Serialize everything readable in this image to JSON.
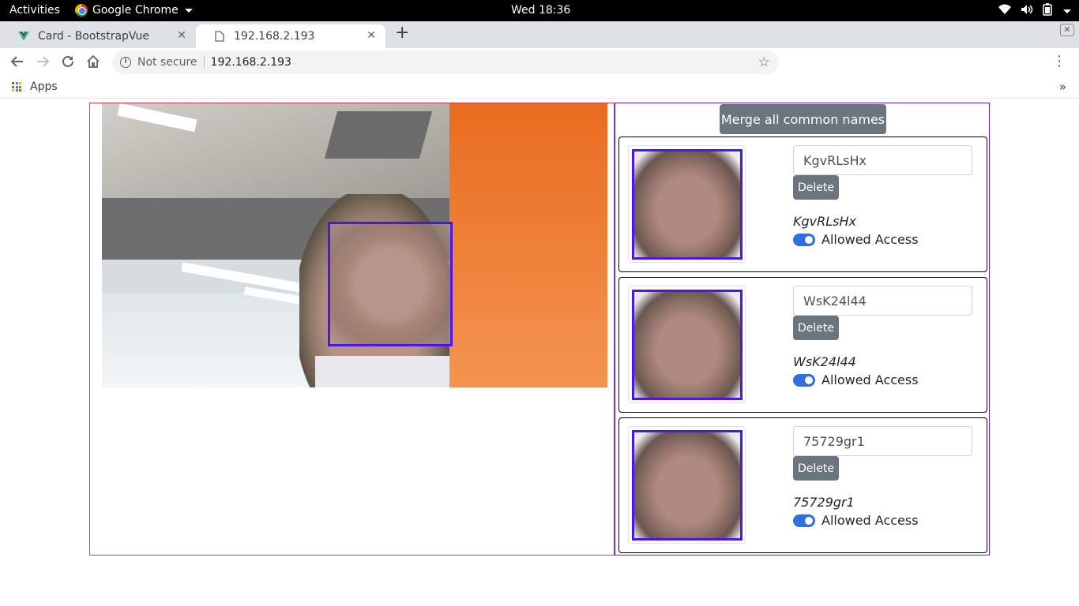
{
  "system": {
    "activities": "Activities",
    "app_name": "Google Chrome",
    "clock": "Wed 18:36"
  },
  "tabs": [
    {
      "title": "Card - BootstrapVue",
      "active": false
    },
    {
      "title": "192.168.2.193",
      "active": true
    }
  ],
  "omnibox": {
    "security": "Not secure",
    "url": "192.168.2.193"
  },
  "bookmarks": {
    "apps_label": "Apps"
  },
  "page": {
    "merge_button": "Merge all common names",
    "cards": [
      {
        "input_value": "KgvRLsHx",
        "delete_label": "Delete",
        "name": "KgvRLsHx",
        "access_label": "Allowed Access",
        "allowed": true
      },
      {
        "input_value": "WsK24l44",
        "delete_label": "Delete",
        "name": "WsK24l44",
        "access_label": "Allowed Access",
        "allowed": true
      },
      {
        "input_value": "75729gr1",
        "delete_label": "Delete",
        "name": "75729gr1",
        "access_label": "Allowed Access",
        "allowed": true
      }
    ]
  },
  "colors": {
    "face_box": "#4b17e6",
    "left_border": "#dc3545",
    "right_border": "#5a1fd1",
    "button_secondary": "#6c757d",
    "switch_on": "#2f6fe0"
  }
}
